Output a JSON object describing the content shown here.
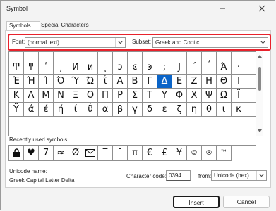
{
  "window": {
    "title": "Symbol"
  },
  "tabs": [
    {
      "label": "Symbols",
      "active": true
    },
    {
      "label": "Special Characters",
      "active": false
    }
  ],
  "font": {
    "label": "Font:",
    "value": "(normal text)"
  },
  "subset": {
    "label": "Subset:",
    "value": "Greek and Coptic"
  },
  "symbol_grid": {
    "rows": [
      [
        "",
        "",
        "",
        "",
        "",
        "",
        "",
        "",
        "",
        "",
        "",
        "",
        "",
        "",
        "",
        "",
        ""
      ],
      [
        "Ͳ",
        "ͳ",
        "ʹ",
        "͵",
        "Ͷ",
        "ͷ",
        "ͺ",
        "ͻ",
        "ͼ",
        "ͽ",
        ";",
        "Ϳ",
        "΄",
        "΅",
        "Ά",
        "·",
        ""
      ],
      [
        "Έ",
        "Ή",
        "Ί",
        "Ό",
        "Ύ",
        "Ώ",
        "ΐ",
        "Α",
        "Β",
        "Γ",
        "Δ",
        "Ε",
        "Ζ",
        "Η",
        "Θ",
        "Ι",
        ""
      ],
      [
        "Κ",
        "Λ",
        "Μ",
        "Ν",
        "Ξ",
        "Ο",
        "Π",
        "Ρ",
        "Σ",
        "Τ",
        "Υ",
        "Φ",
        "Χ",
        "Ψ",
        "Ω",
        "Ϊ",
        ""
      ],
      [
        "Ϋ",
        "ά",
        "έ",
        "ή",
        "ί",
        "ΰ",
        "α",
        "β",
        "γ",
        "δ",
        "ε",
        "ζ",
        "η",
        "θ",
        "ι",
        "κ",
        ""
      ]
    ],
    "selected": {
      "row": 2,
      "col": 10
    }
  },
  "recent": {
    "label": "Recently used symbols:",
    "symbols": [
      "",
      "♥",
      "7",
      "≈",
      "Ø",
      "",
      "‾",
      "¯",
      "π",
      "€",
      "£",
      "¥",
      "©",
      "®",
      "™"
    ]
  },
  "unicode_name": {
    "label": "Unicode name:",
    "value": "Greek Capital Letter Delta"
  },
  "character_code": {
    "label": "Character code:",
    "value": "0394"
  },
  "from": {
    "label": "from:",
    "value": "Unicode (hex)"
  },
  "buttons": {
    "insert": "Insert",
    "cancel": "Cancel"
  },
  "colors": {
    "highlight": "#e8222c",
    "selection": "#0a64c8"
  }
}
